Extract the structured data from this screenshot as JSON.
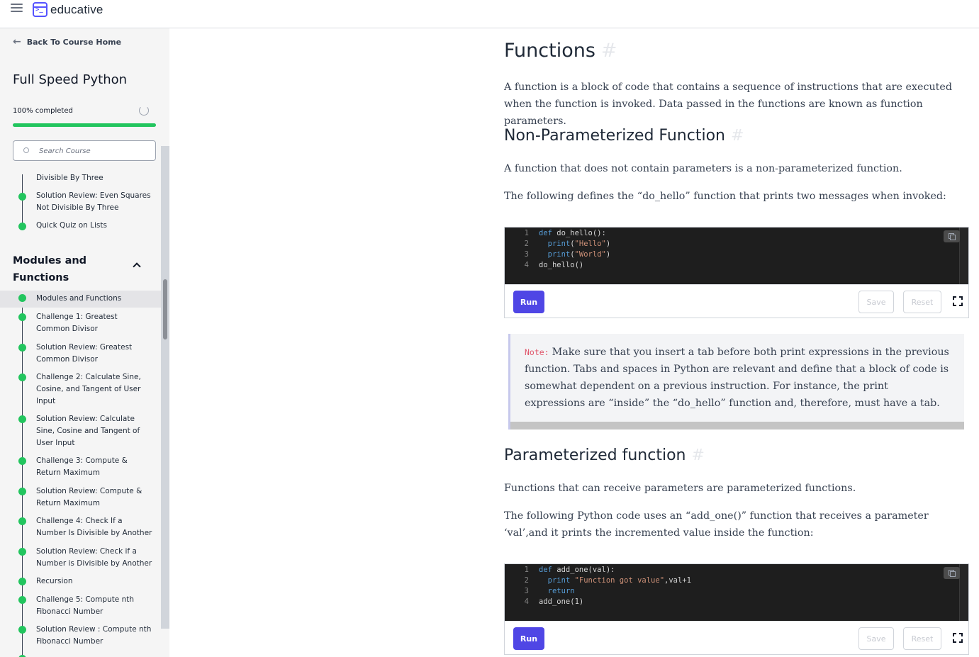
{
  "header": {
    "brand": "educative"
  },
  "sidebar": {
    "back_label": "Back To Course Home",
    "course_title": "Full Speed Python",
    "progress_label": "100% completed",
    "progress_percent": 100,
    "search_placeholder": "Search Course",
    "items_before": [
      {
        "label": "Divisible By Three"
      },
      {
        "label": "Solution Review: Even Squares Not Divisible By Three"
      },
      {
        "label": "Quick Quiz on Lists"
      }
    ],
    "section": {
      "title": "Modules and Functions",
      "items": [
        {
          "label": "Modules and Functions",
          "active": true
        },
        {
          "label": "Challenge 1: Greatest Common Divisor"
        },
        {
          "label": "Solution Review: Greatest Common Divisor"
        },
        {
          "label": "Challenge 2: Calculate Sine, Cosine, and Tangent of User Input"
        },
        {
          "label": "Solution Review: Calculate Sine, Cosine and Tangent of User Input"
        },
        {
          "label": "Challenge 3: Compute & Return Maximum"
        },
        {
          "label": "Solution Review: Compute & Return Maximum"
        },
        {
          "label": "Challenge 4: Check If a Number Is Divisible by Another"
        },
        {
          "label": "Solution Review: Check if a Number is Divisible by Another"
        },
        {
          "label": "Recursion"
        },
        {
          "label": "Challenge 5: Compute nth Fibonacci Number"
        },
        {
          "label": "Solution Review : Compute nth Fibonacci Number"
        }
      ]
    }
  },
  "content": {
    "h1": "Functions",
    "hash": "#",
    "intro": "A function is a block of code that contains a sequence of instructions that are executed when the function is invoked. Data passed in the functions are known as function parameters.",
    "h2_nonparam": "Non-Parameterized Function",
    "nonparam_p1": "A function that does not contain parameters is a non-parameterized function.",
    "nonparam_p2": "The following defines the “do_hello” function that prints two messages when invoked:",
    "code1": {
      "lines": [
        {
          "n": "1",
          "kw": "def",
          "rest": " do_hello():"
        },
        {
          "n": "2",
          "indent": "  ",
          "fn": "print",
          "open": "(",
          "str": "\"Hello\"",
          "close": ")"
        },
        {
          "n": "3",
          "indent": "  ",
          "fn": "print",
          "open": "(",
          "str": "\"World\"",
          "close": ")"
        },
        {
          "n": "4",
          "plain": "do_hello()"
        }
      ]
    },
    "buttons": {
      "run": "Run",
      "save": "Save",
      "reset": "Reset"
    },
    "note_tag": "Note:",
    "note_text": "Make sure that you insert a tab before both print expressions in the previous function. Tabs and spaces in Python are relevant and define that a block of code is somewhat dependent on a previous instruction. For instance, the print expressions are “inside” the “do_hello” function and, therefore, must have a tab.",
    "h2_param": "Parameterized function",
    "param_p1": "Functions that can receive parameters are parameterized functions.",
    "param_p2": "The following Python code uses an “add_one()” function that receives a parameter ‘val’,and it prints the incremented value inside the function:",
    "code2": {
      "lines": [
        {
          "n": "1",
          "kw": "def",
          "rest": " add_one(val):"
        },
        {
          "n": "2",
          "indent": "  ",
          "fn": "print",
          "open": " ",
          "str": "\"Function got value\"",
          "close": ",val+1"
        },
        {
          "n": "3",
          "indent": "  ",
          "kwonly": "return"
        },
        {
          "n": "4",
          "plain": "add_one(1)"
        }
      ]
    }
  },
  "colors": {
    "accent": "#4f46e5",
    "progress": "#22c55e",
    "code_bg": "#1e1e1e"
  }
}
